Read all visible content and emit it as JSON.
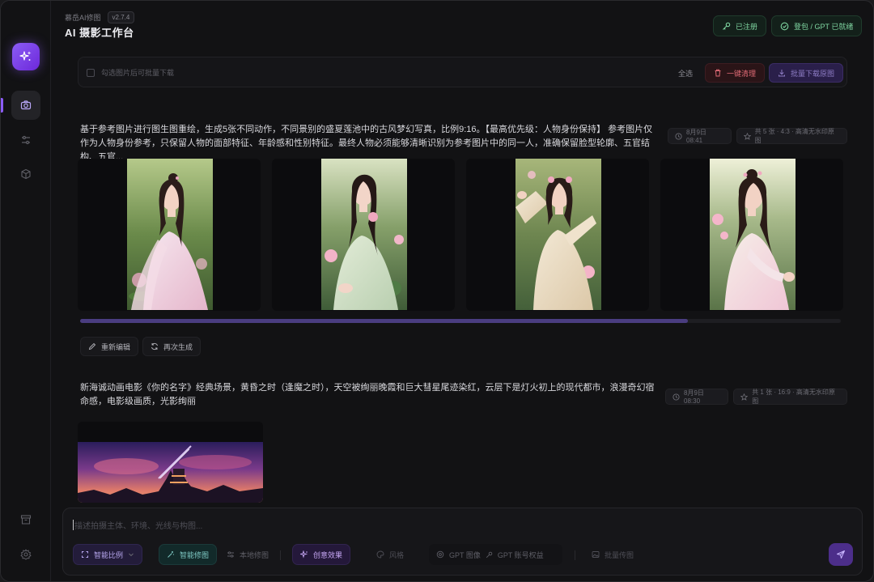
{
  "window": {
    "subtitle": "慕岳AI修图",
    "version": "v2.7.4",
    "title": "AI 摄影工作台"
  },
  "header": {
    "registered_label": "已注册",
    "status_label": "登包 / GPT 已就绪"
  },
  "toolbar": {
    "hint": "勾选图片后可批量下载",
    "select_all": "全选",
    "clear_label": "一键清理",
    "download_label": "批量下载原图"
  },
  "tasks": [
    {
      "prompt": "基于参考图片进行图生图重绘，生成5张不同动作，不同景别的盛夏莲池中的古风梦幻写真，比例9:16。【最高优先级：人物身份保持】 参考图片仅作为人物身份参考，只保留人物的面部特征、年龄感和性别特征。最终人物必须能够清晰识别为参考图片中的同一人，准确保留脸型轮廓、五官结构、五官...",
      "time": "8月9日 08:41",
      "info": "共 5 张 · 4:3 · 高清无水印原图",
      "edit_label": "重新编辑",
      "regen_label": "再次生成"
    },
    {
      "prompt": "新海诚动画电影《你的名字》经典场景，黄昏之时（逢魔之时），天空被绚丽晚霞和巨大彗星尾迹染红，云层下是灯火初上的现代都市，浪漫奇幻宿命感，电影级画质，光影绚丽",
      "time": "8月9日 08:30",
      "info": "共 1 张 · 16:9 · 高清无水印原图"
    }
  ],
  "composer": {
    "placeholder": "描述拍摄主体、环境、光线与构图...",
    "ratio_label": "智能比例",
    "smart_label": "智能修图",
    "local_label": "本地修图",
    "creative_label": "创意效果",
    "style_label": "风格",
    "gpt_image_label": "GPT 图像",
    "gpt_account_label": "GPT 账号权益",
    "batch_label": "批量传图"
  },
  "colors": {
    "accent": "#8b5cf6",
    "background": "#121214",
    "success": "#7fd6a1",
    "danger": "#e06a75"
  },
  "icons": [
    "sparkle-icon",
    "camera-icon",
    "sliders-icon",
    "cube-icon",
    "archive-icon",
    "settings-icon",
    "key-icon",
    "check-circle-icon",
    "trash-icon",
    "download-icon",
    "clock-icon",
    "star-icon",
    "pencil-icon",
    "refresh-icon",
    "expand-icon",
    "magic-wand-icon",
    "palette-icon",
    "image-icon",
    "send-icon"
  ]
}
